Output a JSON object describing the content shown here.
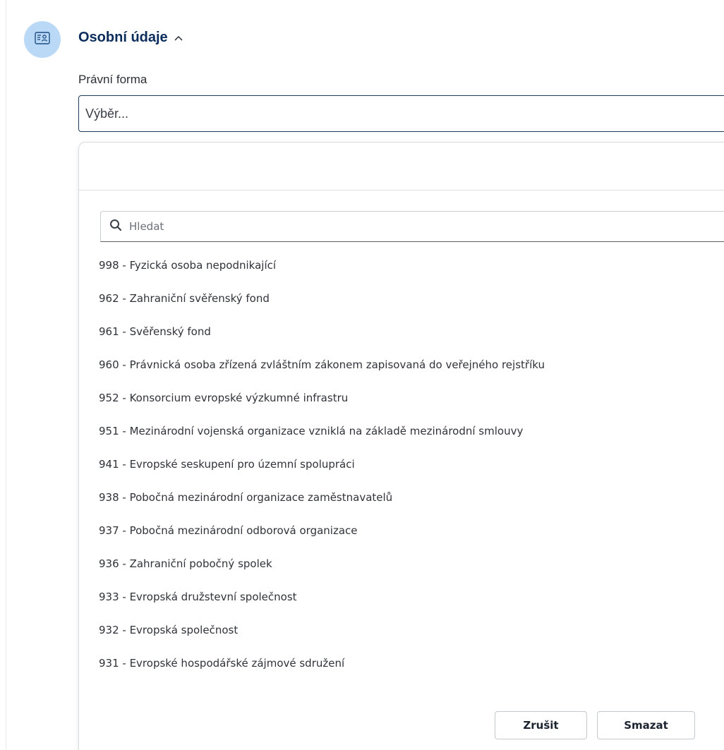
{
  "section": {
    "title": "Osobní údaje",
    "icon": "person-card-icon",
    "toggle_icon": "chevron-up-icon"
  },
  "field": {
    "label": "Právní forma",
    "value": "Výběr..."
  },
  "dropdown": {
    "search_placeholder": "Hledat",
    "options": [
      "998 - Fyzická osoba nepodnikající",
      "962 - Zahraniční svěřenský fond",
      "961 - Svěřenský fond",
      "960 - Právnická osoba zřízená zvláštním zákonem zapisovaná do veřejného rejstříku",
      "952 - Konsorcium evropské výzkumné infrastru",
      "951 - Mezinárodní vojenská organizace vzniklá na základě mezinárodní smlouvy",
      "941 - Evropské seskupení pro územní spolupráci",
      "938 - Pobočná mezinárodní organizace zaměstnavatelů",
      "937 - Pobočná mezinárodní odborová organizace",
      "936 - Zahraniční pobočný spolek",
      "933 - Evropská družstevní společnost",
      "932 - Evropská společnost",
      "931 - Evropské hospodářské zájmové sdružení"
    ],
    "cancel_label": "Zrušit",
    "clear_label": "Smazat"
  },
  "colors": {
    "accent": "#0b2d5b",
    "avatar_bg": "#b9d9f7"
  }
}
